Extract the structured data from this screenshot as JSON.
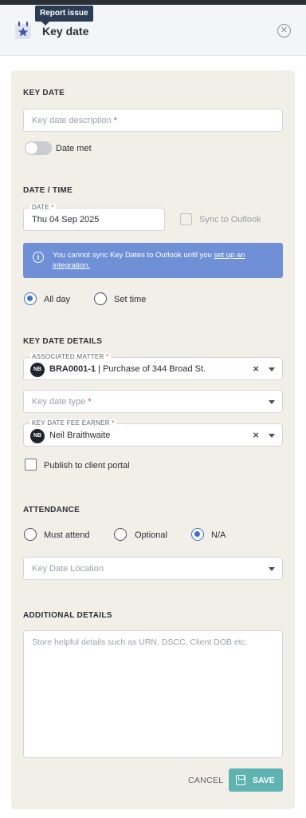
{
  "tooltip": "Report issue",
  "header": {
    "title": "Key date"
  },
  "key_date": {
    "section_title": "KEY DATE",
    "description_placeholder": "Key date description",
    "required_mark": "*",
    "date_met_label": "Date met",
    "date_met_on": false
  },
  "date_time": {
    "section_title": "DATE / TIME",
    "date_label": "DATE",
    "date_value": "Thu 04 Sep 2025",
    "sync_label": "Sync to Outlook",
    "banner_text": "You cannot sync Key Dates to Outlook until you ",
    "banner_link": "set up an integration.",
    "all_day_label": "All day",
    "set_time_label": "Set time",
    "selected": "all_day"
  },
  "details": {
    "section_title": "KEY DATE DETAILS",
    "matter_label": "ASSOCIATED MATTER",
    "matter_avatar": "NB",
    "matter_code": "BRA0001-1",
    "matter_separator": " | ",
    "matter_desc": "Purchase of 344 Broad St.",
    "type_placeholder": "Key date type",
    "fee_earner_label": "KEY DATE FEE EARNER",
    "fee_earner_avatar": "NB",
    "fee_earner_name": "Neil Braithwaite",
    "publish_label": "Publish to client portal",
    "clear_symbol": "×"
  },
  "attendance": {
    "section_title": "ATTENDANCE",
    "options": [
      "Must attend",
      "Optional",
      "N/A"
    ],
    "selected": "N/A",
    "location_placeholder": "Key Date Location"
  },
  "additional": {
    "section_title": "ADDITIONAL DETAILS",
    "placeholder": "Store helpful details such as URN, DSCC, Client DOB etc."
  },
  "actions": {
    "cancel": "CANCEL",
    "save": "SAVE"
  },
  "colors": {
    "accent": "#3f6fcf",
    "banner": "#6f8fd6",
    "save": "#5fb3b3",
    "panel": "#f2efe9"
  }
}
